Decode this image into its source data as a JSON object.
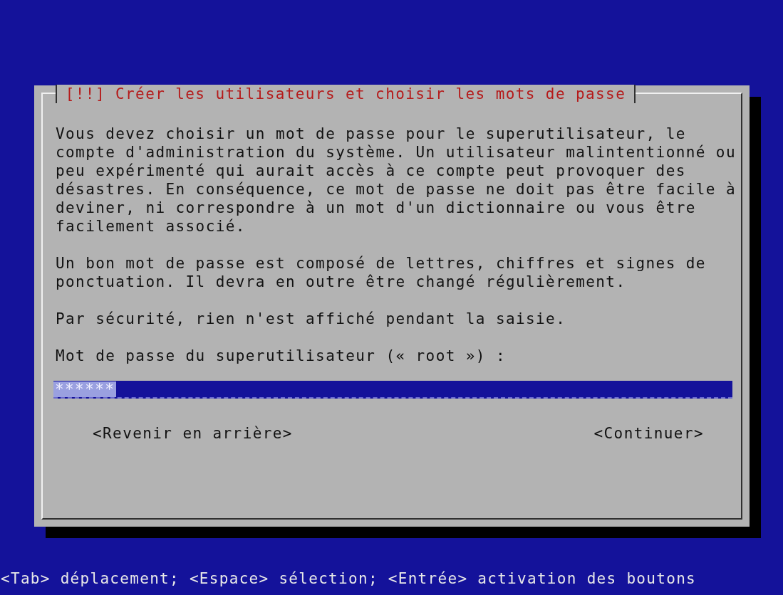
{
  "dialog": {
    "title": "[!!] Créer les utilisateurs et choisir les mots de passe",
    "paragraphs": [
      "Vous devez choisir un mot de passe pour le superutilisateur, le compte d'administration du système. Un utilisateur malintentionné ou peu expérimenté qui aurait accès à ce compte peut provoquer des désastres. En conséquence, ce mot de passe ne doit pas être facile à deviner, ni correspondre à un mot d'un dictionnaire ou vous être facilement associé.",
      "Un bon mot de passe est composé de lettres, chiffres et signes de ponctuation. Il devra en outre être changé régulièrement.",
      "Par sécurité, rien n'est affiché pendant la saisie.",
      "Mot de passe du superutilisateur (« root ») :"
    ],
    "password_field": {
      "value": "******"
    },
    "buttons": [
      {
        "label": "<Revenir en arrière>"
      },
      {
        "label": "<Continuer>"
      }
    ]
  },
  "status_bar": "<Tab> déplacement; <Espace> sélection; <Entrée> activation des boutons"
}
